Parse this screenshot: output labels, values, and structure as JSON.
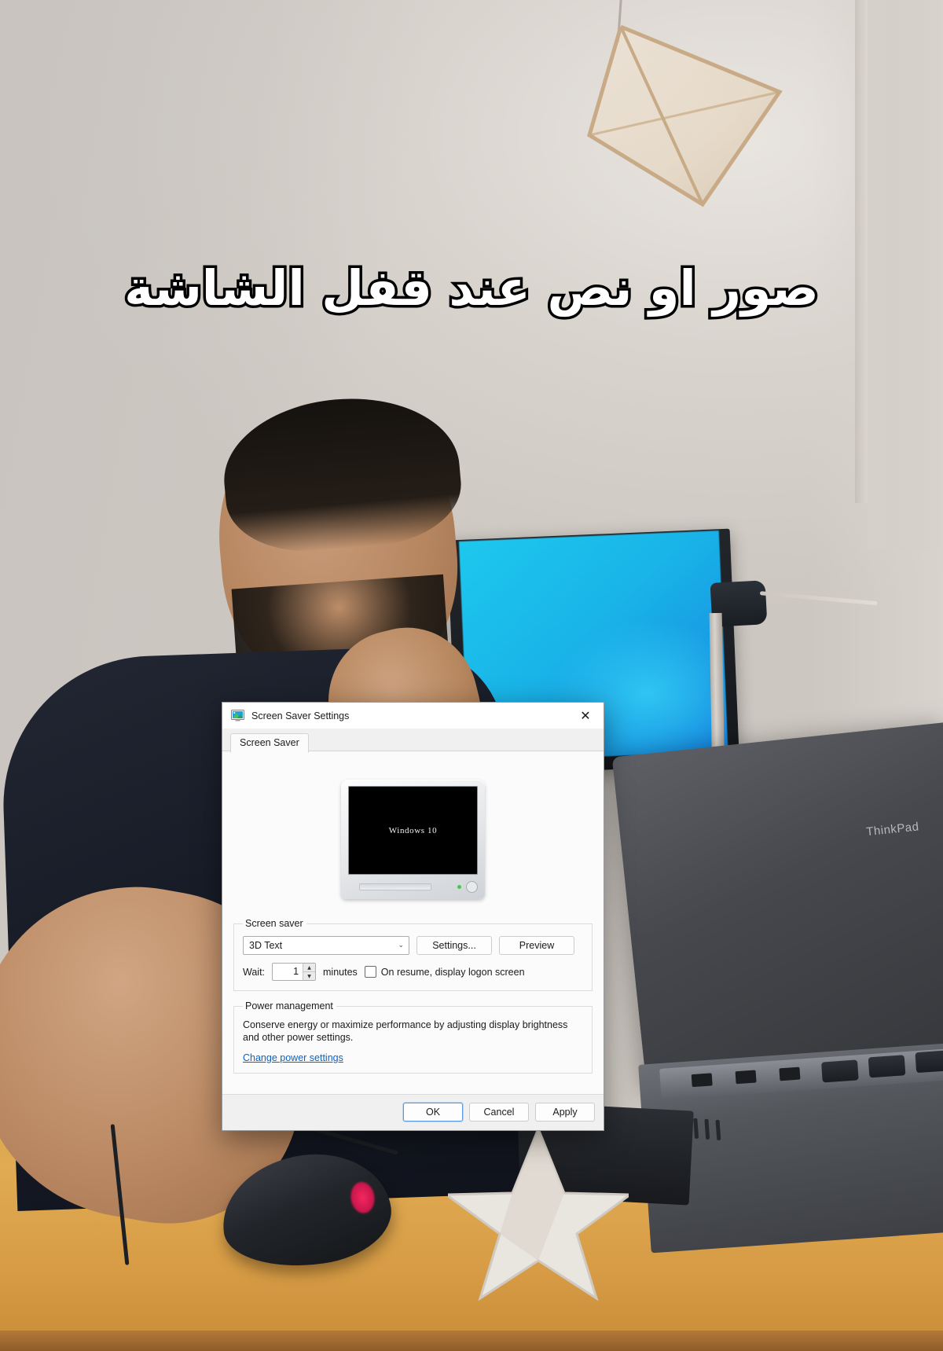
{
  "caption": {
    "text": "صور او نص عند قفل الشاشة"
  },
  "dialog": {
    "title": "Screen Saver Settings",
    "title_icon": "screen-saver-monitor-icon",
    "close_icon": "✕",
    "tabs": [
      {
        "label": "Screen Saver",
        "selected": true
      }
    ],
    "preview": {
      "screen_text": "Windows 10",
      "monitor_icon": "crt-monitor-preview",
      "led_color": "#4ec44e"
    },
    "screen_saver_group": {
      "legend": "Screen saver",
      "selected": "3D Text",
      "dropdown_arrow": "⌄",
      "settings_button": "Settings...",
      "preview_button": "Preview",
      "wait_label": "Wait:",
      "wait_value": "1",
      "spin_up": "▲",
      "spin_down": "▼",
      "minutes_label": "minutes",
      "logon_checkbox_label": "On resume, display logon screen",
      "logon_checkbox_checked": false
    },
    "power_group": {
      "legend": "Power management",
      "description": "Conserve energy or maximize performance by adjusting display brightness and other power settings.",
      "link": "Change power settings",
      "link_color": "#0b63c5"
    },
    "footer": {
      "ok": "OK",
      "cancel": "Cancel",
      "apply": "Apply",
      "default_button": "OK"
    }
  },
  "scene": {
    "laptop_brand": "ThinkPad",
    "colors": {
      "wall": "#d6d1cb",
      "desk": "#dca74f",
      "monitor_screen": "#1ec8ee",
      "dialog_bg": "#f0f0f0",
      "shirt": "#1a1e29"
    }
  }
}
